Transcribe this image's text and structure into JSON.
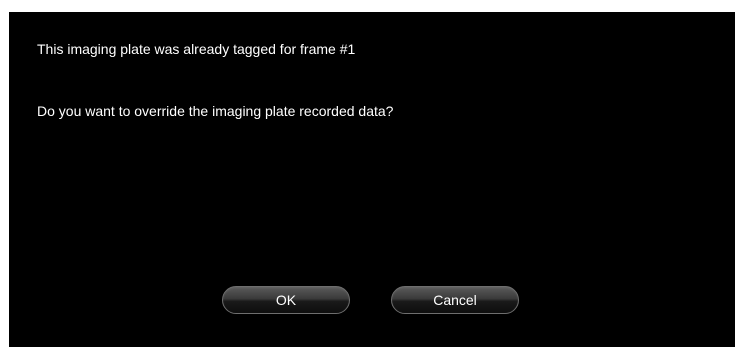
{
  "dialog": {
    "message_line1": "This imaging plate was already tagged for frame #1",
    "message_line2": "Do you want to override the imaging plate recorded data?",
    "ok_label": "OK",
    "cancel_label": "Cancel"
  },
  "colors": {
    "background": "#000000",
    "text": "#ffffff"
  }
}
